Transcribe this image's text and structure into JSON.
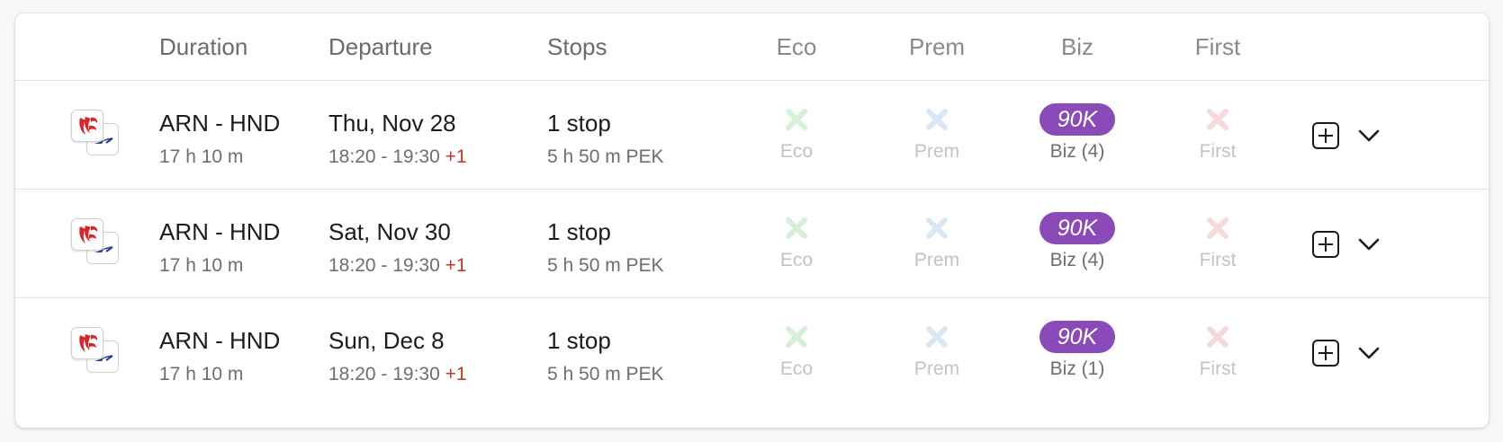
{
  "header": {
    "duration": "Duration",
    "departure": "Departure",
    "stops": "Stops",
    "eco": "Eco",
    "prem": "Prem",
    "biz": "Biz",
    "first": "First"
  },
  "colors": {
    "eco_x": "#d6efd9",
    "prem_x": "#d9e6f4",
    "first_x": "#f6dada",
    "biz_pill": "#8a4bb8",
    "next_day": "#c0392b"
  },
  "rows": [
    {
      "airline_icon": "air-china-logo",
      "route": "ARN - HND",
      "duration": "17 h 10 m",
      "date": "Thu, Nov 28",
      "time": "18:20 - 19:30",
      "day_offset": "+1",
      "stops": "1 stop",
      "layover": "5 h 50 m  PEK",
      "eco": "Eco",
      "prem": "Prem",
      "biz_price": "90K",
      "biz": "Biz (4)",
      "first": "First"
    },
    {
      "airline_icon": "air-china-logo",
      "route": "ARN - HND",
      "duration": "17 h 10 m",
      "date": "Sat, Nov 30",
      "time": "18:20 - 19:30",
      "day_offset": "+1",
      "stops": "1 stop",
      "layover": "5 h 50 m  PEK",
      "eco": "Eco",
      "prem": "Prem",
      "biz_price": "90K",
      "biz": "Biz (4)",
      "first": "First"
    },
    {
      "airline_icon": "air-china-logo",
      "route": "ARN - HND",
      "duration": "17 h 10 m",
      "date": "Sun, Dec 8",
      "time": "18:20 - 19:30",
      "day_offset": "+1",
      "stops": "1 stop",
      "layover": "5 h 50 m  PEK",
      "eco": "Eco",
      "prem": "Prem",
      "biz_price": "90K",
      "biz": "Biz (1)",
      "first": "First"
    }
  ]
}
